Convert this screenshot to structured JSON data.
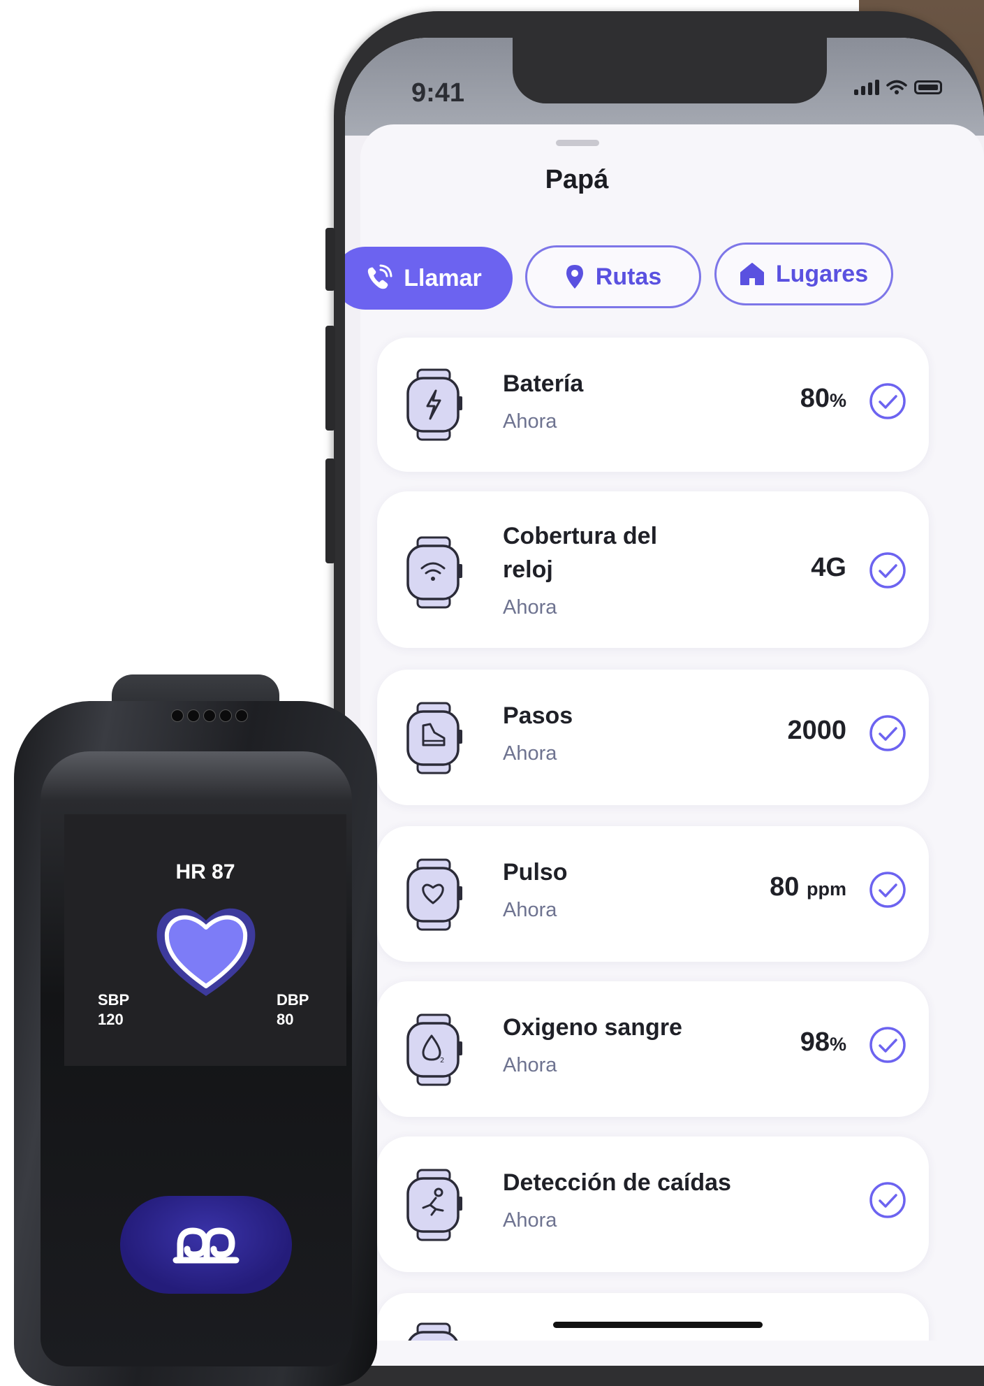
{
  "status_bar": {
    "time": "9:41"
  },
  "sheet": {
    "title": "Papá"
  },
  "actions": [
    {
      "label": "Llamar",
      "icon": "phone-call-icon",
      "style": "primary"
    },
    {
      "label": "Rutas",
      "icon": "map-pin-icon",
      "style": "outline"
    },
    {
      "label": "Lugares",
      "icon": "home-icon",
      "style": "outline"
    }
  ],
  "cards": [
    {
      "title": "Batería",
      "subtitle": "Ahora",
      "value": "80",
      "unit": "%",
      "icon": "watch-battery-icon"
    },
    {
      "title": "Cobertura del reloj",
      "title_lines": [
        "Cobertura del",
        "reloj"
      ],
      "subtitle": "Ahora",
      "value": "4G",
      "unit": "",
      "icon": "watch-wifi-icon"
    },
    {
      "title": "Pasos",
      "subtitle": "Ahora",
      "value": "2000",
      "unit": "",
      "icon": "watch-shoe-icon"
    },
    {
      "title": "Pulso",
      "subtitle": "Ahora",
      "value": "80",
      "unit": "ppm",
      "icon": "watch-heart-icon"
    },
    {
      "title": "Oxigeno sangre",
      "subtitle": "Ahora",
      "value": "98",
      "unit": "%",
      "icon": "watch-oxygen-icon"
    },
    {
      "title": "Detección de caídas",
      "subtitle": "Ahora",
      "value": "",
      "unit": "",
      "icon": "watch-fall-icon"
    }
  ],
  "watch_device": {
    "hr": "HR 87",
    "sbp_label": "SBP",
    "sbp_value": "120",
    "dbp_label": "DBP",
    "dbp_value": "80",
    "button_logo": "brand-logo-icon"
  },
  "colors": {
    "accent": "#6c63f0",
    "accent_outline": "#7d76e8",
    "text_primary": "#1f2027",
    "text_secondary": "#6e7390",
    "heart": "#7d7cf7"
  }
}
